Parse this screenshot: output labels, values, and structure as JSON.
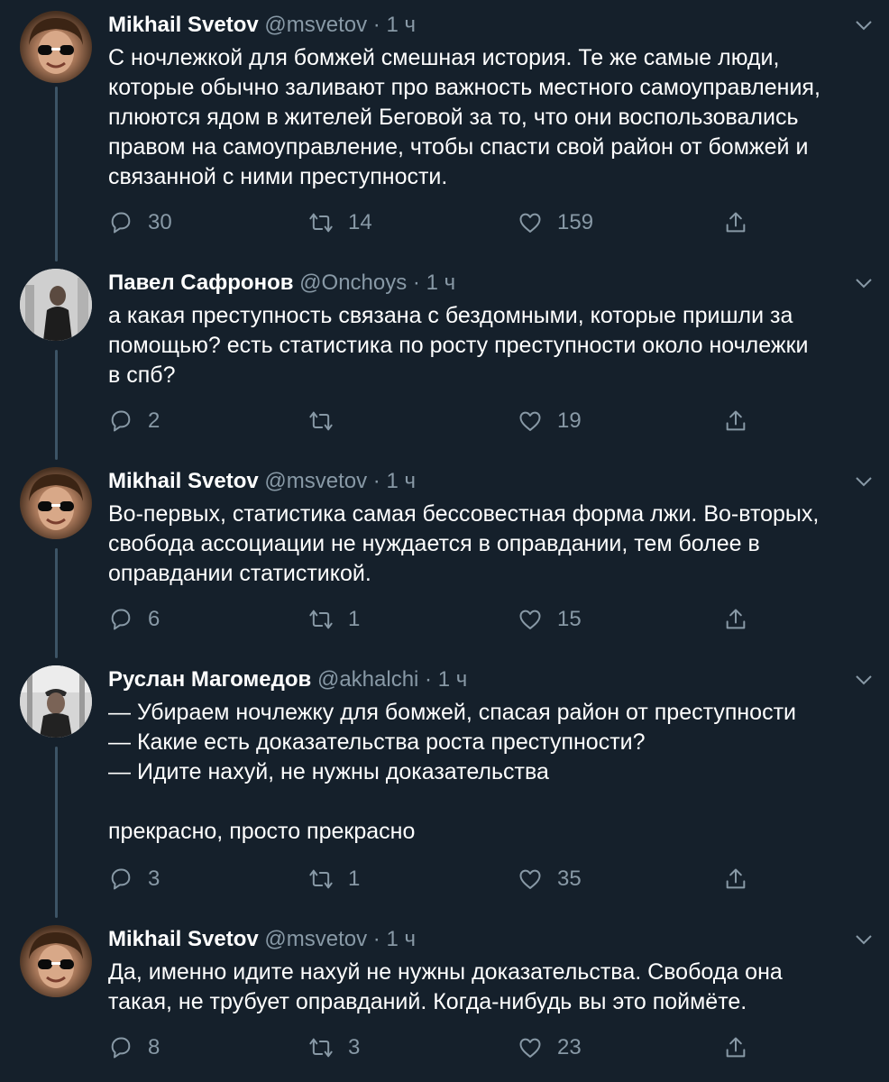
{
  "tweets": [
    {
      "name": "Mikhail Svetov",
      "handle": "@msvetov",
      "time": "· 1 ч",
      "text": "С ночлежкой для бомжей смешная история. Те же самые люди,\nкоторые обычно заливают про важность местного самоуправления,\nплюются ядом в жителей Беговой за то, что они воспользовались\nправом на самоуправление, чтобы спасти свой район от бомжей и\nсвязанной с ними преступности.",
      "replies": "30",
      "retweets": "14",
      "likes": "159"
    },
    {
      "name": "Павел Сафронов",
      "handle": "@Onchoys",
      "time": "· 1 ч",
      "text": "а какая преступность связана с бездомными, которые пришли за\nпомощью? есть статистика по росту преступности около ночлежки\nв спб?",
      "replies": "2",
      "retweets": "",
      "likes": "19"
    },
    {
      "name": "Mikhail Svetov",
      "handle": "@msvetov",
      "time": "· 1 ч",
      "text": "Во-первых, статистика самая бессовестная форма лжи. Во-вторых,\nсвобода ассоциации не нуждается в оправдании, тем более в\nоправдании статистикой.",
      "replies": "6",
      "retweets": "1",
      "likes": "15"
    },
    {
      "name": "Руслан Магомедов",
      "handle": "@akhalchi",
      "time": "· 1 ч",
      "text": "— Убираем ночлежку для бомжей, спасая район от преступности\n— Какие есть доказательства роста преступности?\n— Идите нахуй, не нужны доказательства\n\nпрекрасно, просто прекрасно",
      "replies": "3",
      "retweets": "1",
      "likes": "35"
    },
    {
      "name": "Mikhail Svetov",
      "handle": "@msvetov",
      "time": "· 1 ч",
      "text": "Да, именно идите нахуй не нужны доказательства. Свобода она\nтакая, не трубует оправданий. Когда-нибудь вы это поймёте.",
      "replies": "8",
      "retweets": "3",
      "likes": "23"
    }
  ],
  "icons": {
    "reply": "reply-icon",
    "retweet": "retweet-icon",
    "like": "like-icon",
    "share": "share-icon",
    "more": "chevron-down-icon"
  },
  "colors": {
    "background": "#15202b",
    "text": "#ffffff",
    "secondary": "#8899a6",
    "thread_line": "#3d5466"
  }
}
